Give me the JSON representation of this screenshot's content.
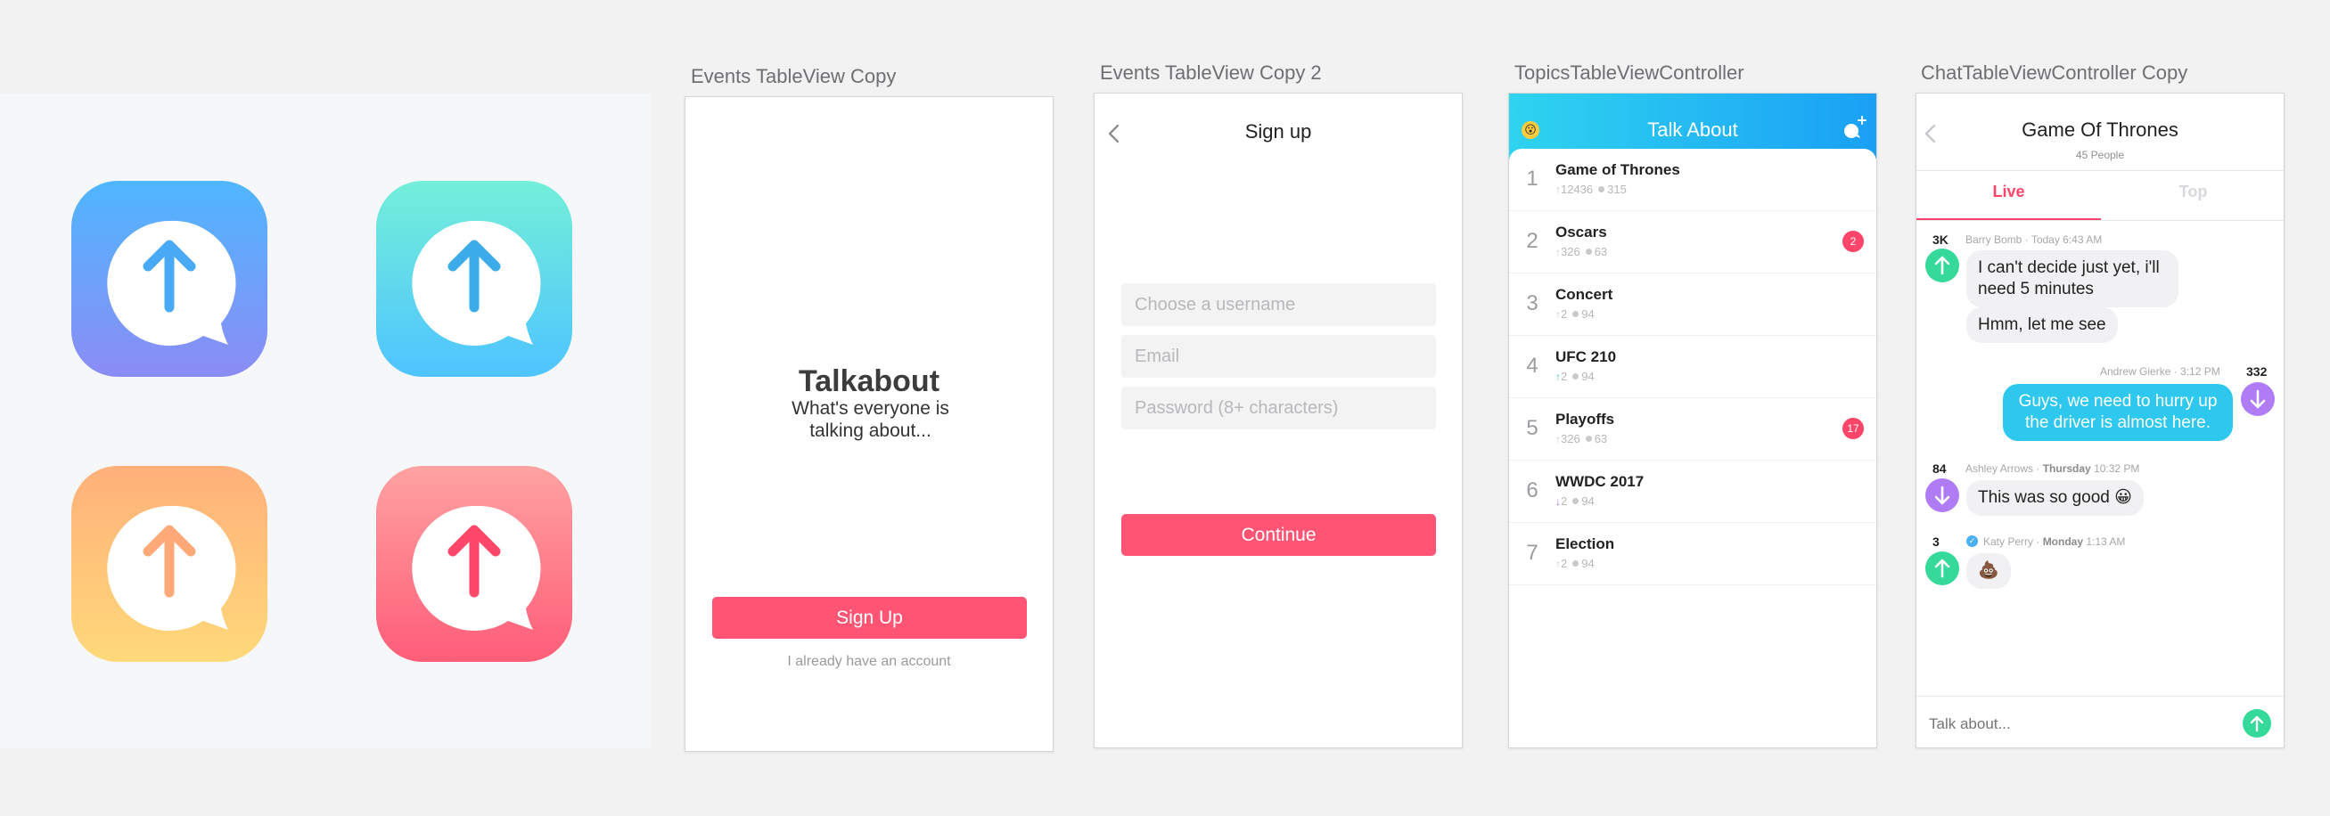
{
  "artboards": {
    "events": "Events TableView Copy",
    "signup": "Events TableView Copy 2",
    "topics": "TopicsTableViewController",
    "chat": "ChatTableViewController Copy"
  },
  "icons": [
    {
      "name": "blue-purple",
      "gradient": [
        "#4fb6ff",
        "#8b8cf5"
      ],
      "arrow": "#4aa9f4"
    },
    {
      "name": "teal-blue",
      "gradient": [
        "#74efd9",
        "#4ec4ff"
      ],
      "arrow": "#3cabea"
    },
    {
      "name": "orange-yellow",
      "gradient": [
        "#ffb07a",
        "#ffd97a"
      ],
      "arrow": "#ffa878"
    },
    {
      "name": "pink-red",
      "gradient": [
        "#ffa2a2",
        "#ff5d78"
      ],
      "arrow": "#ff4769"
    }
  ],
  "welcome": {
    "title": "Talkabout",
    "subtitle": "What's everyone is talking about...",
    "signup_button": "Sign Up",
    "login_link": "I already have an account"
  },
  "signup": {
    "title": "Sign up",
    "username_placeholder": "Choose a username",
    "email_placeholder": "Email",
    "password_placeholder": "Password (8+ characters)",
    "continue_button": "Continue"
  },
  "topics": {
    "title": "Talk About",
    "header_gradient": [
      "#2fd4f0",
      "#1aa0f5"
    ],
    "items": [
      {
        "rank": "1",
        "name": "Game of Thrones",
        "votes": "12436",
        "comments": "315",
        "badge": "",
        "trend": "up"
      },
      {
        "rank": "2",
        "name": "Oscars",
        "votes": "326",
        "comments": "63",
        "badge": "2",
        "trend": "up"
      },
      {
        "rank": "3",
        "name": "Concert",
        "votes": "2",
        "comments": "94",
        "badge": "",
        "trend": "up"
      },
      {
        "rank": "4",
        "name": "UFC 210",
        "votes": "2",
        "comments": "94",
        "badge": "",
        "trend": "up-green"
      },
      {
        "rank": "5",
        "name": "Playoffs",
        "votes": "326",
        "comments": "63",
        "badge": "17",
        "trend": "up"
      },
      {
        "rank": "6",
        "name": "WWDC 2017",
        "votes": "2",
        "comments": "94",
        "badge": "",
        "trend": "down-purple"
      },
      {
        "rank": "7",
        "name": "Election",
        "votes": "2",
        "comments": "94",
        "badge": "",
        "trend": "up"
      }
    ]
  },
  "chat": {
    "title": "Game Of Thrones",
    "subtitle": "45 People",
    "tab_live": "Live",
    "tab_top": "Top",
    "input_placeholder": "Talk about...",
    "messages": {
      "m1": {
        "count": "3K",
        "author": "Barry Bomb",
        "time": "Today 6:43 AM",
        "text1": "I can't decide just yet, i'll need 5 minutes",
        "text2": "Hmm, let me see"
      },
      "m2": {
        "count": "332",
        "author": "Andrew Gierke",
        "time": "3:12 PM",
        "text": "Guys, we need to hurry up the driver is almost here."
      },
      "m3": {
        "count": "84",
        "author": "Ashley Arrows",
        "day": "Thursday",
        "time": "10:32 PM",
        "text": "This was so good 😀"
      },
      "m4": {
        "count": "3",
        "author": "Katy Perry",
        "day": "Monday",
        "time": "1:13 AM",
        "text": "💩"
      }
    },
    "colors": {
      "up": "#35d99a",
      "down": "#b07cf5",
      "accent": "#ff4569",
      "bubble": "#2ec8ee"
    }
  }
}
